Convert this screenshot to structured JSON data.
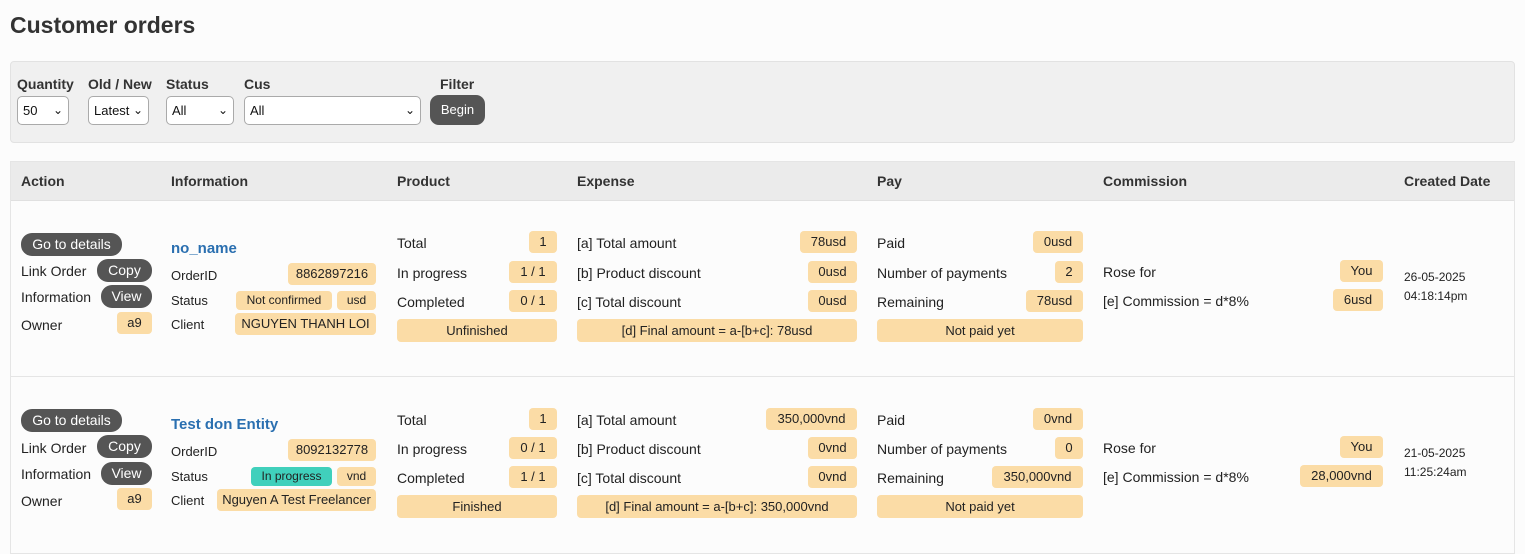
{
  "page": {
    "title": "Customer orders"
  },
  "filters": {
    "quantity": {
      "label": "Quantity",
      "value": "50"
    },
    "old_new": {
      "label": "Old / New",
      "value": "Latest"
    },
    "status": {
      "label": "Status",
      "value": "All"
    },
    "cus": {
      "label": "Cus",
      "value": "All"
    },
    "filter": {
      "label": "Filter",
      "button": "Begin"
    }
  },
  "columns": [
    "Action",
    "Information",
    "Product",
    "Expense",
    "Pay",
    "Commission",
    "Created Date"
  ],
  "labels": {
    "go_to_details": "Go to details",
    "link_order": "Link Order",
    "copy": "Copy",
    "information": "Information",
    "view": "View",
    "owner": "Owner",
    "order_id": "OrderID",
    "status": "Status",
    "client": "Client",
    "total": "Total",
    "in_progress": "In progress",
    "completed": "Completed",
    "total_amount": "[a] Total amount",
    "product_discount": "[b] Product discount",
    "total_discount": "[c] Total discount",
    "paid": "Paid",
    "num_payments": "Number of payments",
    "remaining": "Remaining",
    "rose_for": "Rose for",
    "commission_formula": "[e] Commission = d*8%"
  },
  "orders": [
    {
      "owner": "a9",
      "name": "no_name",
      "order_id": "8862897216",
      "status": "Not confirmed",
      "currency": "usd",
      "client": "NGUYEN THANH LOI",
      "product_total": "1",
      "product_in_progress": "1 / 1",
      "product_completed": "0 / 1",
      "product_state": "Unfinished",
      "total_amount": "78usd",
      "product_discount": "0usd",
      "total_discount": "0usd",
      "final_amount": "[d] Final amount = a-[b+c]: 78usd",
      "paid": "0usd",
      "num_payments": "2",
      "remaining": "78usd",
      "pay_state": "Not paid yet",
      "rose_for": "You",
      "commission": "6usd",
      "created_date": "26-05-2025",
      "created_time": "04:18:14pm"
    },
    {
      "owner": "a9",
      "name": "Test don Entity",
      "order_id": "8092132778",
      "status": "In progress",
      "currency": "vnd",
      "client": "Nguyen A Test Freelancer",
      "product_total": "1",
      "product_in_progress": "0 / 1",
      "product_completed": "1 / 1",
      "product_state": "Finished",
      "total_amount": "350,000vnd",
      "product_discount": "0vnd",
      "total_discount": "0vnd",
      "final_amount": "[d] Final amount = a-[b+c]: 350,000vnd",
      "paid": "0vnd",
      "num_payments": "0",
      "remaining": "350,000vnd",
      "pay_state": "Not paid yet",
      "rose_for": "You",
      "commission": "28,000vnd",
      "created_date": "21-05-2025",
      "created_time": "11:25:24am"
    }
  ],
  "colors": {
    "badge": "#fbdca6",
    "in_progress": "#40d0bc",
    "dark_button": "#555555",
    "link": "#2a6fb0"
  }
}
